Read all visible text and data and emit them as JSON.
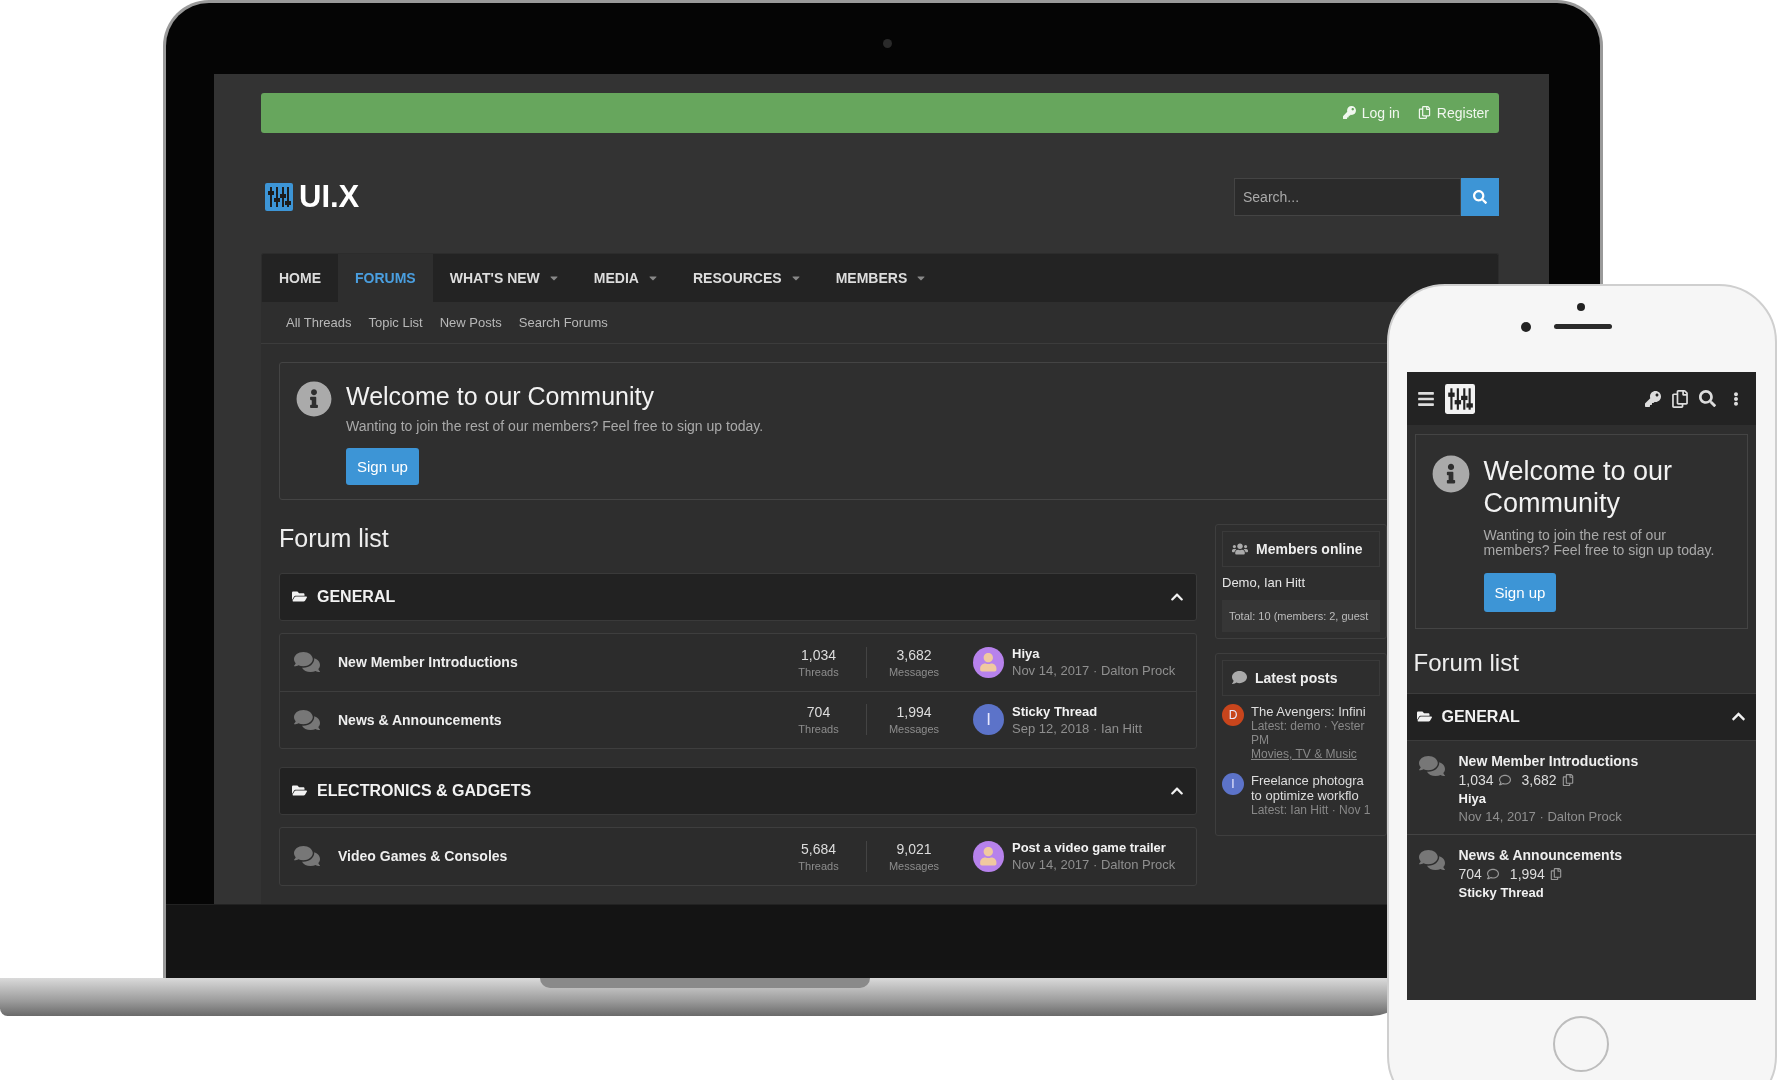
{
  "laptop": {
    "top_bar": {
      "links": [
        {
          "label": "Log in",
          "kind": "login"
        },
        {
          "label": "Register",
          "kind": "register"
        }
      ]
    },
    "logo": {
      "text": "UI.X"
    },
    "search": {
      "placeholder": "Search..."
    },
    "nav": [
      {
        "label": "HOME",
        "selected": false,
        "dropdown": false
      },
      {
        "label": "FORUMS",
        "selected": true,
        "dropdown": false
      },
      {
        "label": "WHAT'S NEW",
        "selected": false,
        "dropdown": true
      },
      {
        "label": "MEDIA",
        "selected": false,
        "dropdown": true
      },
      {
        "label": "RESOURCES",
        "selected": false,
        "dropdown": true
      },
      {
        "label": "MEMBERS",
        "selected": false,
        "dropdown": true
      }
    ],
    "subnav": [
      "All Threads",
      "Topic List",
      "New Posts",
      "Search Forums"
    ],
    "notice": {
      "title": "Welcome to our Community",
      "text": "Wanting to join the rest of our members? Feel free to sign up today.",
      "button": "Sign up"
    },
    "forum_list": {
      "title": "Forum list",
      "categories": [
        {
          "name": "GENERAL",
          "expanded": true,
          "forums": [
            {
              "name": "New Member Introductions",
              "threads": "1,034",
              "threads_label": "Threads",
              "messages": "3,682",
              "messages_label": "Messages",
              "latest_title": "Hiya",
              "latest_meta": "Nov 14, 2017 · Dalton Prock",
              "avatar": {
                "kind": "photo",
                "color": "#b782ec"
              }
            },
            {
              "name": "News & Announcements",
              "threads": "704",
              "threads_label": "Threads",
              "messages": "1,994",
              "messages_label": "Messages",
              "latest_title": "Sticky Thread",
              "latest_meta": "Sep 12, 2018 · Ian Hitt",
              "avatar": {
                "kind": "letter",
                "letter": "I",
                "color": "#5c73c9"
              }
            }
          ]
        },
        {
          "name": "ELECTRONICS & GADGETS",
          "expanded": true,
          "forums": [
            {
              "name": "Video Games & Consoles",
              "threads": "5,684",
              "threads_label": "Threads",
              "messages": "9,021",
              "messages_label": "Messages",
              "latest_title": "Post a video game trailer",
              "latest_meta": "Nov 14, 2017 · Dalton Prock",
              "avatar": {
                "kind": "photo",
                "color": "#b782ec"
              }
            }
          ]
        }
      ]
    },
    "sidebar": {
      "members_online": {
        "title": "Members online",
        "names": "Demo, Ian Hitt",
        "total": "Total: 10 (members: 2, guest"
      },
      "latest_posts": {
        "title": "Latest posts",
        "posts": [
          {
            "avatar": {
              "kind": "letter",
              "letter": "D",
              "color": "#c8451c"
            },
            "title_lines": [
              "The Avengers: Infini"
            ],
            "meta_lines": [
              "Latest: demo · Yester",
              "PM"
            ],
            "category": "Movies, TV & Music"
          },
          {
            "avatar": {
              "kind": "letter",
              "letter": "I",
              "color": "#5c73c9"
            },
            "title_lines": [
              "Freelance photogra",
              "to optimize workflo"
            ],
            "meta_lines": [
              "Latest: Ian Hitt · Nov 1"
            ]
          }
        ]
      }
    }
  },
  "phone": {
    "notice": {
      "title": "Welcome to our Community",
      "text": "Wanting to join the rest of our members? Feel free to sign up today.",
      "button": "Sign up"
    },
    "forum_list": {
      "title": "Forum list",
      "categories": [
        {
          "name": "GENERAL",
          "expanded": true,
          "forums": [
            {
              "name": "New Member Introductions",
              "threads": "1,034",
              "messages": "3,682",
              "latest_title": "Hiya",
              "latest_meta": "Nov 14, 2017 · Dalton Prock"
            },
            {
              "name": "News & Announcements",
              "threads": "704",
              "messages": "1,994",
              "latest_title": "Sticky Thread"
            }
          ]
        }
      ]
    }
  }
}
